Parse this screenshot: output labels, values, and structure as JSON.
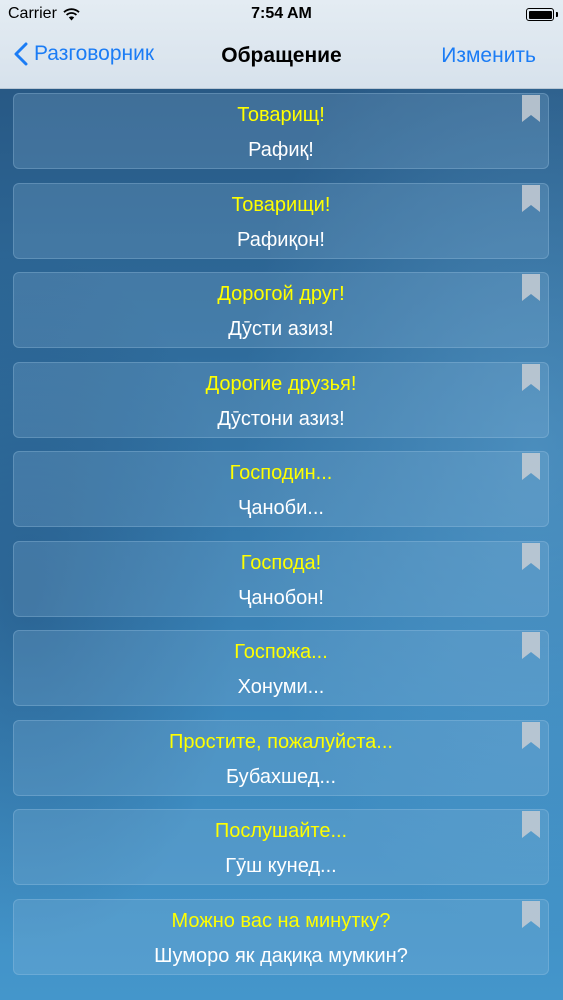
{
  "status_bar": {
    "carrier": "Carrier",
    "time": "7:54 AM",
    "wifi_icon": "wifi-icon",
    "battery_icon": "battery-icon",
    "battery_level": 1.0
  },
  "nav": {
    "back_label": "Разговорник",
    "back_icon": "chevron-left-icon",
    "title": "Обращение",
    "edit_label": "Изменить",
    "tint_color": "#1b7cf5"
  },
  "colors": {
    "phrase_ru": "#ffff00",
    "phrase_tj": "#ffffff",
    "bookmark": "#c7ccd3"
  },
  "bookmark_icon": "bookmark-icon",
  "phrases": [
    {
      "ru": "Товарищ!",
      "tj": "Рафиқ!"
    },
    {
      "ru": "Товарищи!",
      "tj": "Рафиқон!"
    },
    {
      "ru": "Дорогой друг!",
      "tj": "Дӯсти азиз!"
    },
    {
      "ru": "Дорогие друзья!",
      "tj": "Дӯстони азиз!"
    },
    {
      "ru": "Господин...",
      "tj": "Ҷаноби..."
    },
    {
      "ru": "Господа!",
      "tj": "Ҷанобон!"
    },
    {
      "ru": "Госпожа...",
      "tj": "Хонуми..."
    },
    {
      "ru": "Простите, пожалуйста...",
      "tj": "Бубахшед..."
    },
    {
      "ru": "Послушайте...",
      "tj": "Гӯш кунед..."
    },
    {
      "ru": "Можно вас на минутку?",
      "tj": "Шуморо як дақиқа мумкин?"
    }
  ]
}
